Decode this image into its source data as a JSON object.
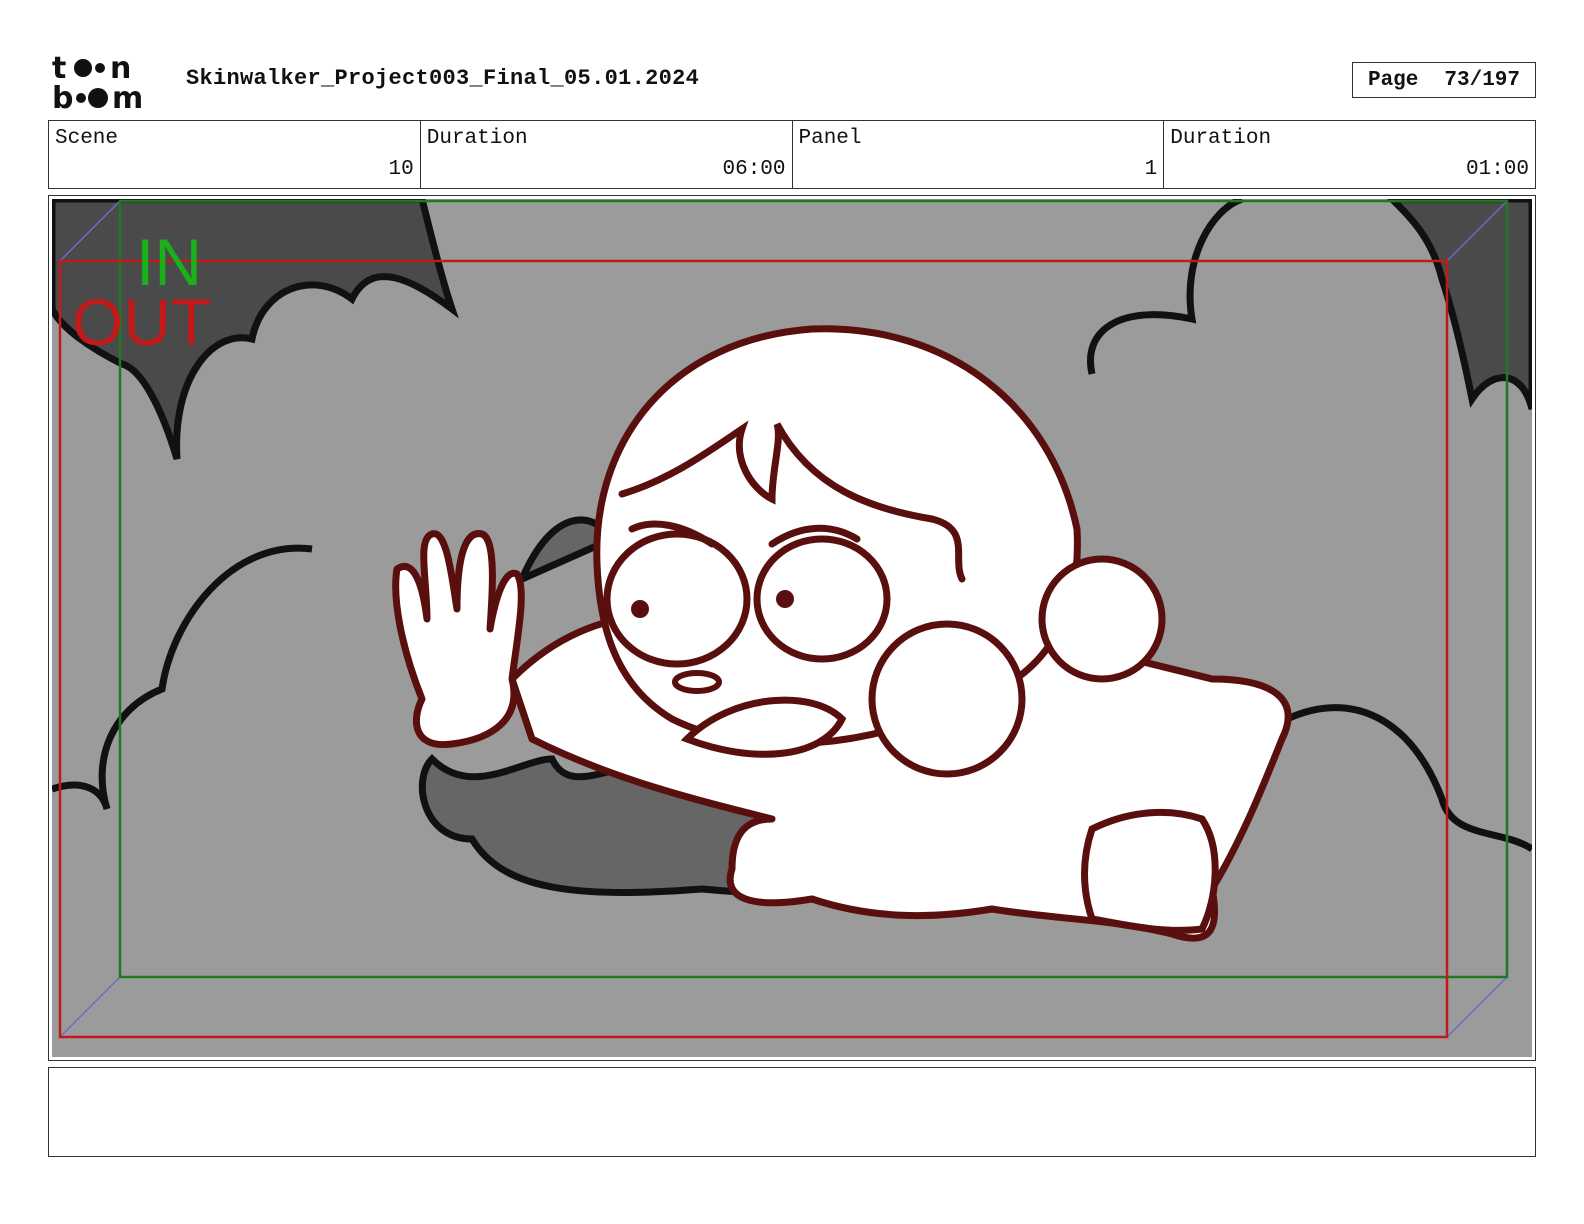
{
  "header": {
    "logo_text": "toon boom",
    "title": "Skinwalker_Project003_Final_05.01.2024",
    "page_label": "Page",
    "page_value": "73/197"
  },
  "info": {
    "scene_label": "Scene",
    "scene_value": "10",
    "scene_duration_label": "Duration",
    "scene_duration_value": "06:00",
    "panel_label": "Panel",
    "panel_value": "1",
    "panel_duration_label": "Duration",
    "panel_duration_value": "01:00"
  },
  "panel": {
    "in_label": "IN",
    "out_label": "OUT",
    "colors": {
      "background": "#9b9b9b",
      "cloud_dark": "#4a4a4a",
      "cloud_mid": "#666666",
      "line_art": "#5a0f0f",
      "in_frame": "#1f7a1f",
      "out_frame": "#c01a1a",
      "camera_guides": "#6b6bc8"
    }
  },
  "caption": {
    "text": ""
  }
}
